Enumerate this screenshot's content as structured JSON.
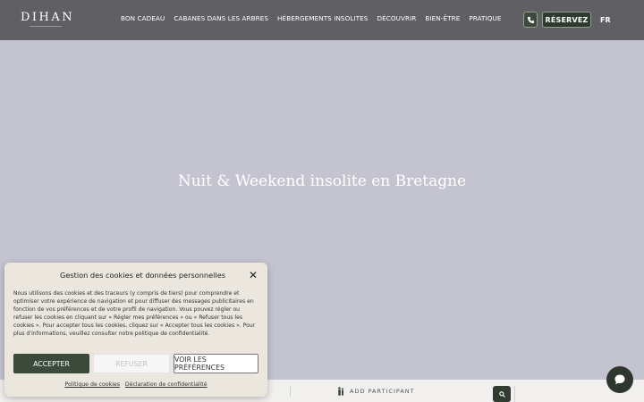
{
  "header": {
    "logo": "DIHAN",
    "nav": [
      "BON CADEAU",
      "CABANES DANS LES ARBRES",
      "HÉBERGEMENTS INSOLITES",
      "DÉCOUVRIR",
      "BIEN-ÊTRE",
      "PRATIQUE"
    ],
    "reserve_label": "RÉSERVEZ",
    "lang": "FR"
  },
  "hero": {
    "title": "Nuit & Weekend insolite en Bretagne"
  },
  "search": {
    "participant_label": "ADD PARTICIPANT"
  },
  "cookie": {
    "title": "Gestion des cookies et données personnelles",
    "body": "Nous utilisons des cookies et des traceurs (y compris de tiers) pour comprendre et optimiser votre expérience de navigation et pour diffuser des messages publicitaires en fonction de vos préférences et de votre profil de navigation. Vous pouvez régler ou refuser les cookies en cliquant sur « Régler mes préférences » ou « Refuser tous les cookies ». Pour accepter tous les cookies, cliquez sur « Accepter tous les cookies ». Pour plus d'informations, veuillez consulter notre politique de confidentialité.",
    "accept": "ACCEPTER",
    "refuse": "REFUSER",
    "prefs": "VOIR LES PRÉFÉRENCES",
    "link_cookies": "Politique de cookies",
    "link_privacy": "Déclaration de confidentialité"
  },
  "colors": {
    "header_bg": "#606064",
    "hero_bg": "#c3c4d0",
    "accent_green": "#313c31",
    "cookie_bg": "#ebe7df"
  }
}
